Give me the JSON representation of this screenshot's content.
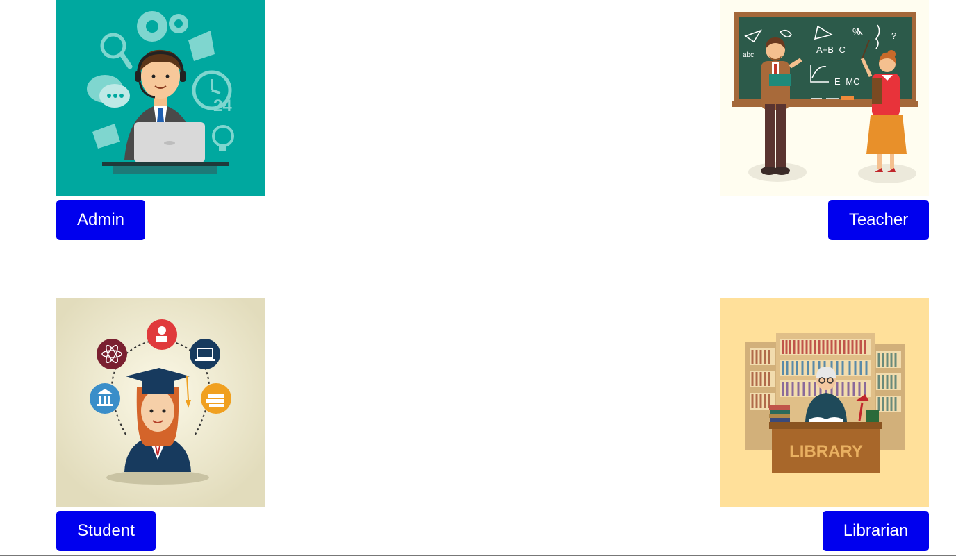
{
  "colors": {
    "button_bg": "#0000ee",
    "button_text": "#ffffff",
    "admin_bg": "#00a89f",
    "teacher_bg": "#fffdf0",
    "student_bg": "#e9e4c8",
    "librarian_bg": "#ffe09a"
  },
  "roles": {
    "admin": {
      "label": "Admin",
      "illustration": "support-agent-illustration"
    },
    "teacher": {
      "label": "Teacher",
      "illustration": "chalkboard-teachers-illustration"
    },
    "student": {
      "label": "Student",
      "illustration": "graduate-student-illustration"
    },
    "librarian": {
      "label": "Librarian",
      "illustration": "library-desk-illustration",
      "sign_text": "LIBRARY"
    }
  }
}
